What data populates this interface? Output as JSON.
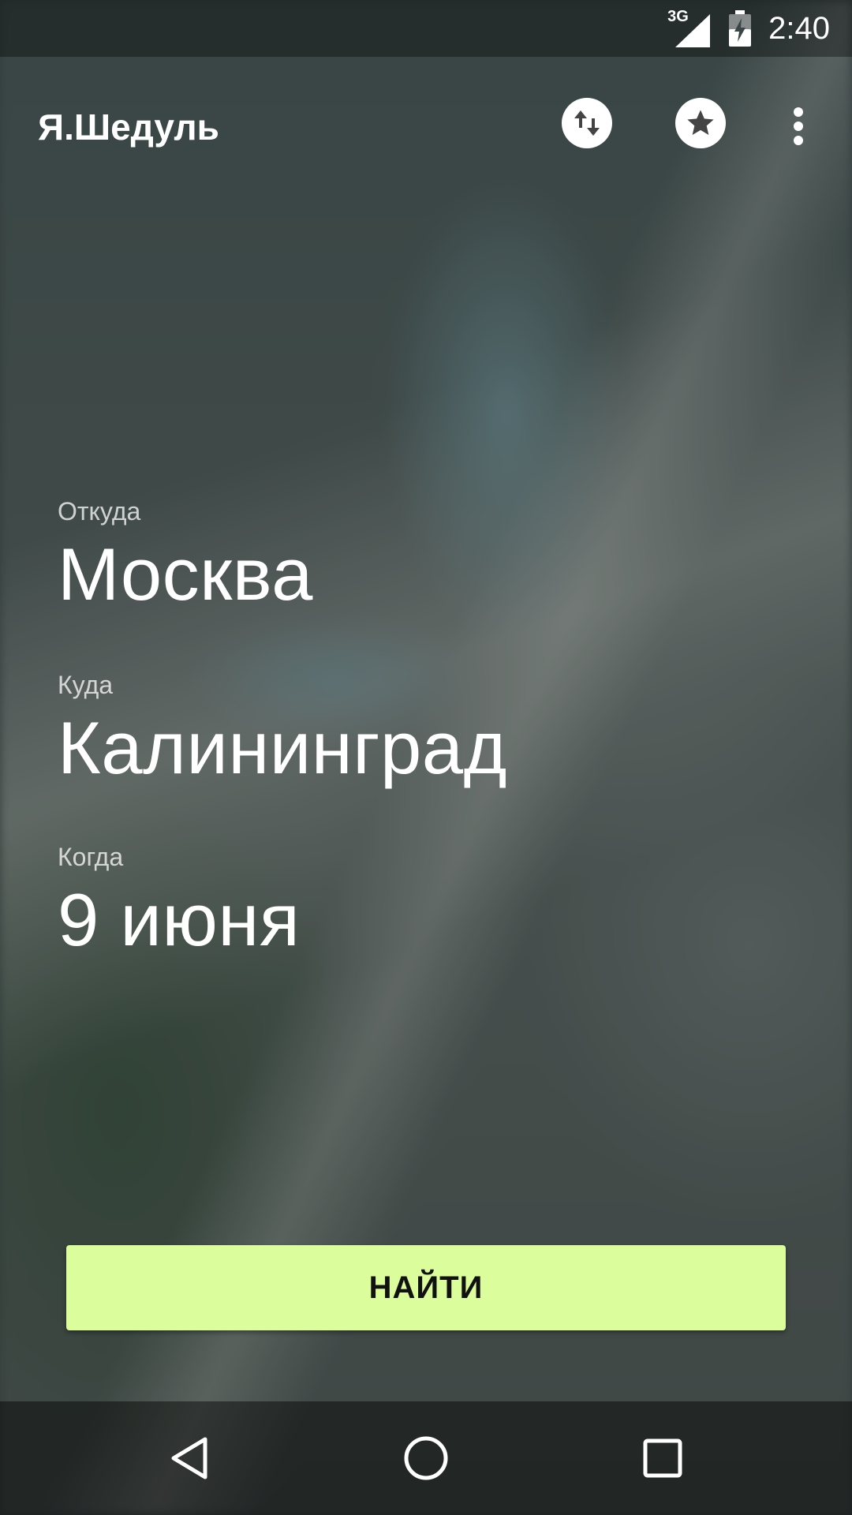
{
  "status_bar": {
    "network_label": "3G",
    "time": "2:40",
    "icons": [
      "signal-icon",
      "battery-charging-icon"
    ]
  },
  "app_bar": {
    "title": "Я.Шедуль",
    "actions": [
      "swap-icon",
      "star-icon",
      "more-vert-icon"
    ]
  },
  "form": {
    "from": {
      "label": "Откуда",
      "value": "Москва"
    },
    "to": {
      "label": "Куда",
      "value": "Калининград"
    },
    "date": {
      "label": "Когда",
      "value": "9 июня"
    }
  },
  "search_button": {
    "label": "НАЙТИ",
    "color": "#dbfd9c"
  },
  "nav_bar": {
    "icons": [
      "back-icon",
      "home-icon",
      "recents-icon"
    ]
  }
}
